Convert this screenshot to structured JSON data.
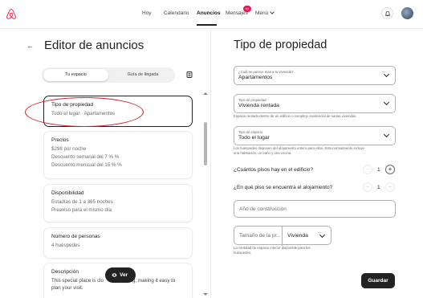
{
  "nav": {
    "hoy": "Hoy",
    "calendario": "Calendario",
    "anuncios": "Anuncios",
    "mensajes": "Mensajes",
    "mensajes_badge": "•••",
    "menu": "Menú"
  },
  "editor": {
    "back_icon": "←",
    "title": "Editor de anuncios",
    "tabs": [
      "Tu espacio",
      "Guía de llegada"
    ]
  },
  "cards": [
    {
      "title": "Tipo de propiedad",
      "lines": [
        "Todo el lugar · Apartamentos"
      ]
    },
    {
      "title": "Precios",
      "lines": [
        "$298 por noche",
        "Descuento semanal del 7 % %",
        "Descuento mensual del 15 % %"
      ]
    },
    {
      "title": "Disponibilidad",
      "lines": [
        "Estadías de 1 a 365 noches",
        "Preaviso para el mismo día"
      ]
    },
    {
      "title": "Número de personas",
      "lines": [
        "4 huéspedes"
      ]
    },
    {
      "title": "Descripción",
      "lines": [
        "This special place is clo",
        "plan your visit."
      ],
      "tail": "g, making it easy to"
    }
  ],
  "ver_button": "Ver",
  "property": {
    "title": "Tipo de propiedad",
    "field1_sub": "¿Cuál se parece más a tu vivienda?",
    "field1_val": "Apartamentos",
    "field2_sub": "Tipo de propiedad",
    "field2_val": "Vivienda rentada",
    "field2_help": "Espacio rentado dentro de un edificio o complejo residencial de varias viviendas.",
    "field3_sub": "Tipo de espacio",
    "field3_val": "Todo el lugar",
    "field3_help_1": "Los huéspedes disponen del alojamiento entero para ellos. Esto normalmente incluye",
    "field3_help_2": "una habitación, un baño y una cocina.",
    "q_floors": "¿Cuántos pisos hay en el edificio?",
    "q_floors_val": "1",
    "q_floor": "¿En qué piso se encuentra el alojamiento?",
    "q_floor_val": "1",
    "year_placeholder": "Año de construcción",
    "size_placeholder": "Tamaño de la pr...",
    "size_unit": "Vivienda",
    "size_help_1": "La cantidad de espacio interior disponible para los",
    "size_help_2": "huéspedes.",
    "save": "Guardar"
  },
  "colors": {
    "brand": "#FF385C",
    "annotation": "#D8202A",
    "dark": "#222222"
  }
}
